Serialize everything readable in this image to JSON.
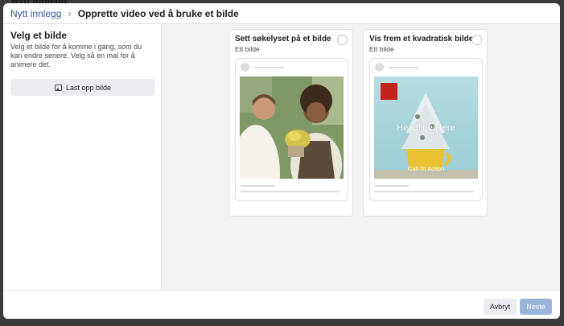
{
  "background": {
    "page_title": "Nytt innlegg"
  },
  "header": {
    "breadcrumb_root": "Nytt innlegg",
    "breadcrumb_current": "Opprette video ved å bruke et bilde"
  },
  "left": {
    "title": "Velg et bilde",
    "description": "Velg et bilde for å komme i gang, som du kan endre senere. Velg så en mal for å animere det.",
    "upload_label": "Last opp bilde",
    "upload_icon": "image-upload-icon"
  },
  "templates": [
    {
      "title": "Sett søkelyset på et bilde",
      "subtitle": "Ett bilde"
    },
    {
      "title": "Vis frem et kvadratisk bilde",
      "subtitle": "Ett bilde",
      "headline": "Headline Here",
      "cta": "Call To Action"
    }
  ],
  "footer": {
    "cancel_label": "Avbryt",
    "next_label": "Neste"
  },
  "colors": {
    "link": "#385898",
    "primary_disabled": "#9cb4d8",
    "logo_red": "#c2231d"
  }
}
